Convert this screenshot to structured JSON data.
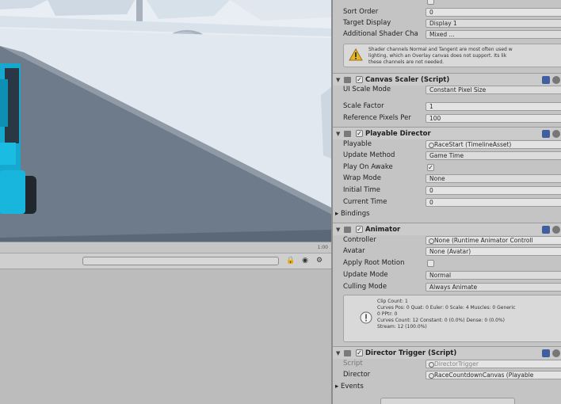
{
  "scene": {
    "colors": {
      "sky": "#e8edf3",
      "ground": "#dfe6ee",
      "road": "#6f7d8c",
      "kart": "#1fb3d6"
    }
  },
  "timeline": {
    "top_readout": "1:00",
    "icons": [
      "lock-icon",
      "eye-icon",
      "gear-icon"
    ]
  },
  "inspector": {
    "canvas": {
      "sort_order_label": "Sort Order",
      "sort_order_value": "0",
      "target_display_label": "Target Display",
      "target_display_value": "Display 1",
      "shader_channels_label": "Additional Shader Cha",
      "shader_channels_value": "Mixed ...",
      "warning_lines": [
        "Shader channels Normal and Tangent are most often used w",
        "lighting, which an Overlay canvas does not support. Its lik",
        "these channels are not needed."
      ]
    },
    "canvas_scaler": {
      "title": "Canvas Scaler (Script)",
      "ui_scale_mode_label": "UI Scale Mode",
      "ui_scale_mode_value": "Constant Pixel Size",
      "scale_factor_label": "Scale Factor",
      "scale_factor_value": "1",
      "ref_ppu_label": "Reference Pixels Per",
      "ref_ppu_value": "100"
    },
    "playable_director": {
      "title": "Playable Director",
      "playable_label": "Playable",
      "playable_value": "RaceStart (TimelineAsset)",
      "update_method_label": "Update Method",
      "update_method_value": "Game Time",
      "play_on_awake_label": "Play On Awake",
      "wrap_mode_label": "Wrap Mode",
      "wrap_mode_value": "None",
      "initial_time_label": "Initial Time",
      "initial_time_value": "0",
      "current_time_label": "Current Time",
      "current_time_value": "0",
      "bindings_label": "Bindings"
    },
    "animator": {
      "title": "Animator",
      "controller_label": "Controller",
      "controller_value": "None (Runtime Animator Controll",
      "avatar_label": "Avatar",
      "avatar_value": "None (Avatar)",
      "apply_root_motion_label": "Apply Root Motion",
      "update_mode_label": "Update Mode",
      "update_mode_value": "Normal",
      "culling_mode_label": "Culling Mode",
      "culling_mode_value": "Always Animate",
      "info_lines": [
        "Clip Count: 1",
        "Curves Pos: 0 Quat: 0 Euler: 0 Scale: 4 Muscles: 0 Generic",
        "0 PPtr: 0",
        "Curves Count: 12 Constant: 0 (0.0%) Dense: 0 (0.0%)",
        "Stream: 12 (100.0%)"
      ]
    },
    "director_trigger": {
      "title": "Director Trigger (Script)",
      "script_label": "Script",
      "script_value": "DirectorTrigger",
      "director_label": "Director",
      "director_value": "RaceCountdownCanvas (Playable",
      "events_label": "Events"
    }
  }
}
